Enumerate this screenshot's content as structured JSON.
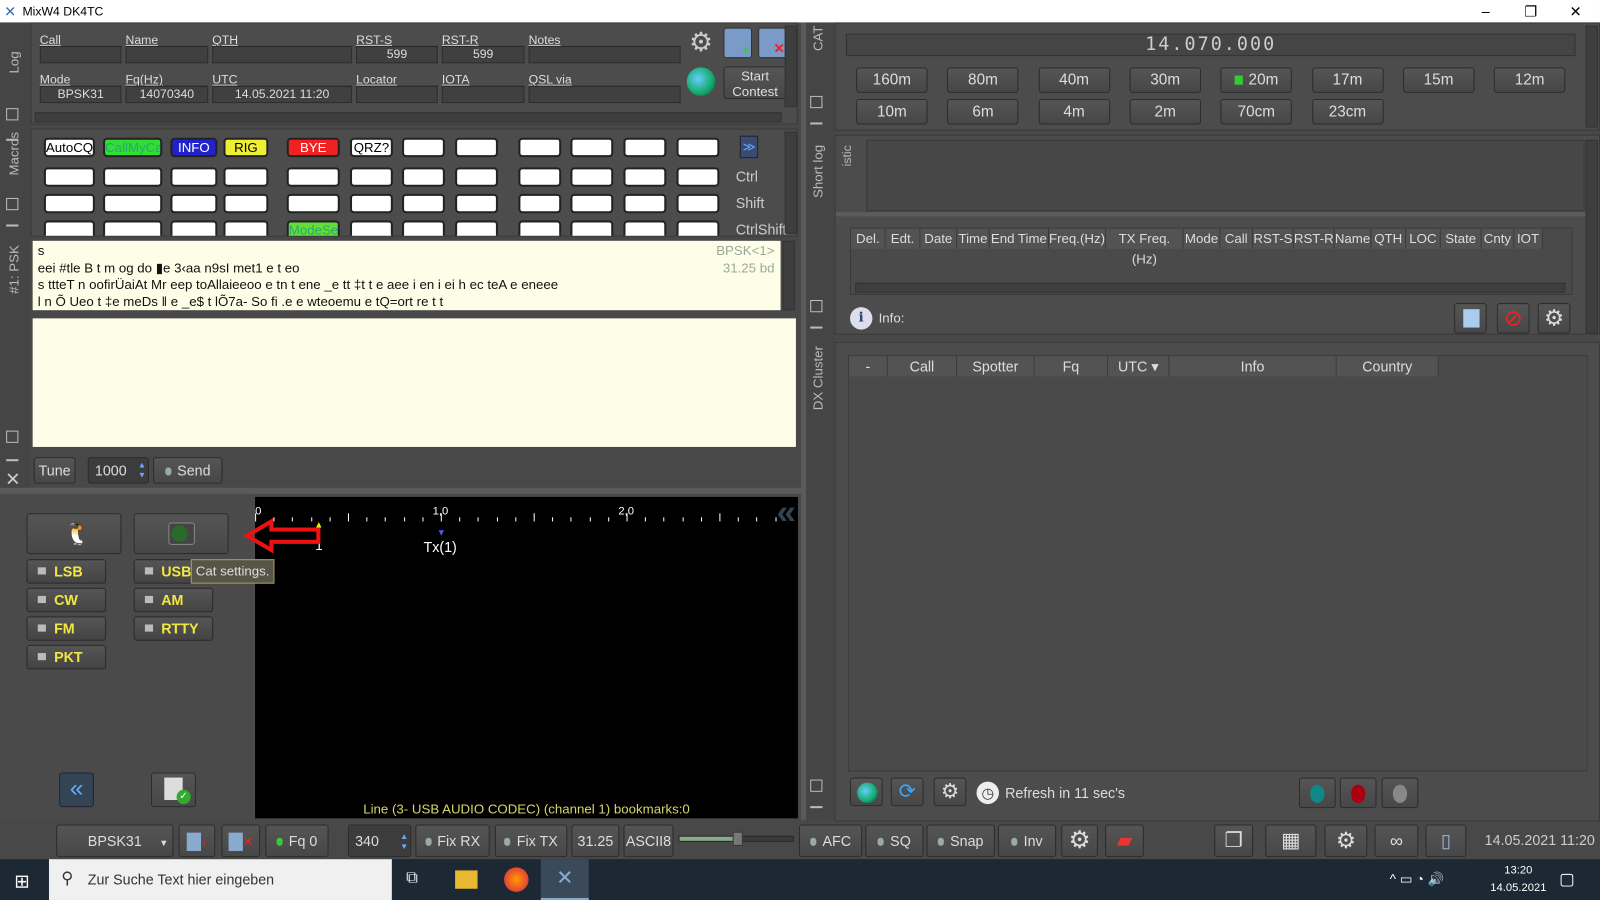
{
  "title_bar": {
    "title": "MixW4 DK4TC",
    "minimize": "–",
    "restore": "❐",
    "close": "✕"
  },
  "side_labels": {
    "log": "Log",
    "macros": "Macros",
    "psk": "#1: PSK",
    "cat": "CAT",
    "short_log": "Short log",
    "statistic": "istic",
    "dx_cluster": "DX Cluster"
  },
  "log": {
    "row1": [
      {
        "label": "Call",
        "value": ""
      },
      {
        "label": "Name",
        "value": ""
      },
      {
        "label": "QTH",
        "value": ""
      },
      {
        "label": "RST-S",
        "value": "599"
      },
      {
        "label": "RST-R",
        "value": "599"
      },
      {
        "label": "Notes",
        "value": ""
      }
    ],
    "row2": [
      {
        "label": "Mode",
        "value": "BPSK31"
      },
      {
        "label": "Fq(Hz)",
        "value": "14070340"
      },
      {
        "label": "UTC",
        "value": "14.05.2021 11:20"
      },
      {
        "label": "Locator",
        "value": ""
      },
      {
        "label": "IOTA",
        "value": ""
      },
      {
        "label": "QSL via",
        "value": ""
      }
    ],
    "start_contest": "Start Contest"
  },
  "macros": {
    "rows": [
      [
        {
          "label": "AutoCQ",
          "color": "#ffffff"
        },
        {
          "label": "CallMyCal",
          "color": "#33dd33"
        },
        {
          "label": "INFO",
          "color": "#2222cc"
        },
        {
          "label": "RIG",
          "color": "#eeee33"
        },
        {
          "label": "BYE",
          "color": "#ee2222"
        },
        {
          "label": "QRZ?",
          "color": "#ffffff"
        },
        {
          "label": ""
        },
        {
          "label": ""
        },
        {
          "label": ""
        },
        {
          "label": ""
        },
        {
          "label": ""
        },
        {
          "label": ""
        }
      ],
      [
        {
          "label": ""
        },
        {
          "label": ""
        },
        {
          "label": ""
        },
        {
          "label": ""
        },
        {
          "label": ""
        },
        {
          "label": ""
        },
        {
          "label": ""
        },
        {
          "label": ""
        },
        {
          "label": ""
        },
        {
          "label": ""
        },
        {
          "label": ""
        },
        {
          "label": ""
        }
      ],
      [
        {
          "label": ""
        },
        {
          "label": ""
        },
        {
          "label": ""
        },
        {
          "label": ""
        },
        {
          "label": ""
        },
        {
          "label": ""
        },
        {
          "label": ""
        },
        {
          "label": ""
        },
        {
          "label": ""
        },
        {
          "label": ""
        },
        {
          "label": ""
        },
        {
          "label": ""
        }
      ],
      [
        {
          "label": ""
        },
        {
          "label": ""
        },
        {
          "label": ""
        },
        {
          "label": ""
        },
        {
          "label": "ModeSet",
          "color": "#66dd33"
        },
        {
          "label": ""
        },
        {
          "label": ""
        },
        {
          "label": ""
        },
        {
          "label": ""
        },
        {
          "label": ""
        },
        {
          "label": ""
        },
        {
          "label": ""
        }
      ]
    ],
    "row_labels": [
      "",
      "Ctrl",
      "Shift",
      "CtrlShift"
    ]
  },
  "rx": {
    "mode": "BPSK<1>",
    "baud": "31.25 bd",
    "lines": [
      "s",
      "eei #tle B t m og do ▮e 3‹aa n9sI met1 e t eo",
      "s ttteT n oofirÜaiAt Mr eep toAllaieeoo e tn t ene _e tt ‡t t e aee i en i ei h ec teA e eneee",
      "l n Õ Ueo t ‡e meDs ‖ e _e$ t lÕ7a- So fi .e e wteoemu e tQ=ort re t t"
    ]
  },
  "tx": {
    "text": ""
  },
  "tune": {
    "tune": "Tune",
    "value": "1000",
    "send": "Send"
  },
  "waterfall": {
    "ticks": [
      "0",
      "1,0",
      "2,0"
    ],
    "rx_marker": "1",
    "tx_marker": "Tx(1)",
    "footer": "Line (3- USB AUDIO  CODEC) (channel 1) bookmarks:0",
    "tooltip": "Cat settings."
  },
  "modes": [
    "LSB",
    "USB",
    "CW",
    "AM",
    "FM",
    "RTTY",
    "PKT"
  ],
  "status": {
    "mode": "BPSK31",
    "fq": "Fq 0",
    "spin": "340",
    "fix_rx": "Fix RX",
    "fix_tx": "Fix TX",
    "baud": "31.25",
    "charset": "ASCII8",
    "afc": "AFC",
    "sq": "SQ",
    "snap": "Snap",
    "inv": "Inv",
    "datetime": "14.05.2021 11:20",
    "slider": 0.5
  },
  "cat": {
    "frequency": "14.070.000",
    "bands": [
      "160m",
      "80m",
      "40m",
      "30m",
      "20m",
      "17m",
      "15m",
      "12m",
      "10m",
      "6m",
      "4m",
      "2m",
      "70cm",
      "23cm"
    ],
    "active_band": "20m",
    "active_color": "#33cc33"
  },
  "short_log": {
    "columns": [
      "Del.",
      "Edt.",
      "Date",
      "Time",
      "End Time",
      "Freq.(Hz)",
      "TX Freq.(Hz)",
      "Mode",
      "Call",
      "RST-S",
      "RST-R",
      "Name",
      "QTH",
      "LOC",
      "State",
      "Cnty",
      "IOT"
    ],
    "info": "Info:"
  },
  "dx_cluster": {
    "columns": [
      "-",
      "Call",
      "Spotter",
      "Fq",
      "UTC ▾",
      "Info",
      "Country"
    ],
    "refresh": "Refresh in 11 sec's",
    "status_colors": [
      "#118888",
      "#aa0011",
      "#888888"
    ]
  },
  "taskbar": {
    "search_placeholder": "Zur Suche Text hier eingeben",
    "time": "13:20",
    "date": "14.05.2021"
  }
}
